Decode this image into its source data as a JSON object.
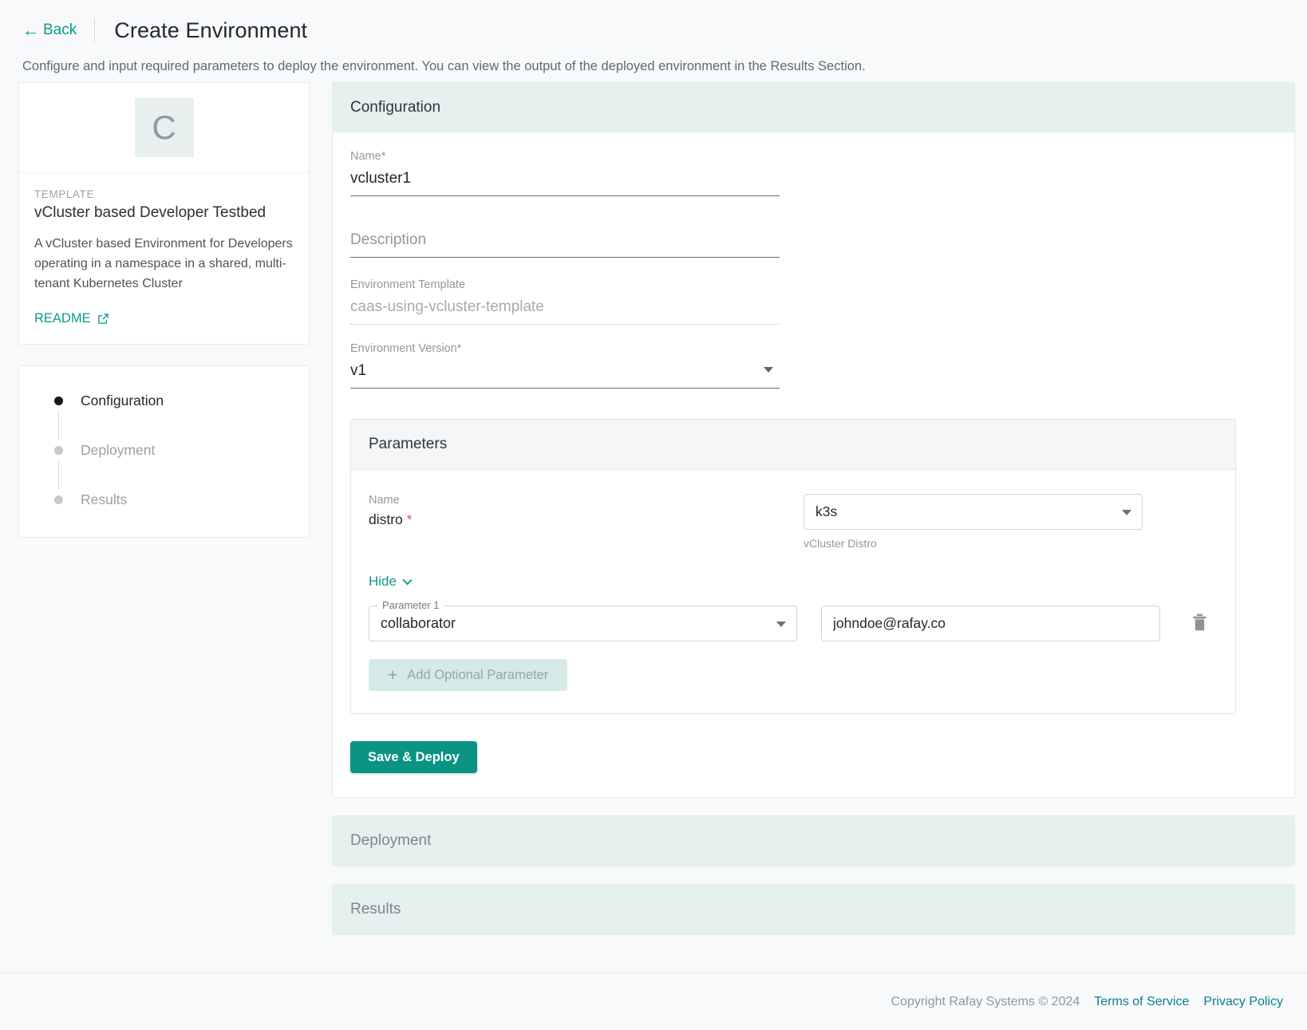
{
  "header": {
    "back_label": "Back",
    "back_icon": "arrow-left-icon",
    "title": "Create Environment",
    "subtitle": "Configure and input required parameters to deploy the environment. You can view the output of the deployed environment in the Results Section."
  },
  "template_card": {
    "logo_letter": "C",
    "kicker": "TEMPLATE",
    "name": "vCluster based Developer Testbed",
    "description": "A vCluster based Environment for Developers operating in a namespace in a shared, multi-tenant Kubernetes Cluster",
    "readme_label": "README",
    "readme_icon": "external-link-icon"
  },
  "stepper": {
    "steps": [
      {
        "label": "Configuration",
        "active": true
      },
      {
        "label": "Deployment",
        "active": false
      },
      {
        "label": "Results",
        "active": false
      }
    ]
  },
  "configuration": {
    "panel_title": "Configuration",
    "fields": {
      "name": {
        "label": "Name",
        "required": "*",
        "value": "vcluster1"
      },
      "description": {
        "label": "",
        "placeholder": "Description",
        "value": ""
      },
      "environment_template": {
        "label": "Environment Template",
        "value": "caas-using-vcluster-template"
      },
      "environment_version": {
        "label": "Environment Version",
        "required": "*",
        "value": "v1"
      }
    }
  },
  "parameters": {
    "panel_title": "Parameters",
    "required_param": {
      "name_kicker": "Name",
      "name": "distro",
      "required_mark": "*",
      "value": "k3s",
      "help_text": "vCluster Distro"
    },
    "toggle_label": "Hide",
    "toggle_icon": "chevron-down-icon",
    "optional_params": [
      {
        "legend": "Parameter 1",
        "key": "collaborator",
        "value": "johndoe@rafay.co",
        "delete_icon": "trash-icon"
      }
    ],
    "add_button": {
      "label": "Add Optional Parameter",
      "icon": "plus-icon"
    }
  },
  "actions": {
    "save_deploy_label": "Save & Deploy"
  },
  "collapsed_panels": [
    {
      "title": "Deployment"
    },
    {
      "title": "Results"
    }
  ],
  "footer": {
    "copyright": "Copyright Rafay Systems © 2024",
    "terms_label": "Terms of Service",
    "privacy_label": "Privacy Policy"
  },
  "colors": {
    "brand_teal": "#0b9384",
    "panel_head_teal": "#e4f1ef",
    "link_teal": "#0a9b8a",
    "required_red": "#e8534f",
    "page_bg": "#f7f9fa"
  }
}
